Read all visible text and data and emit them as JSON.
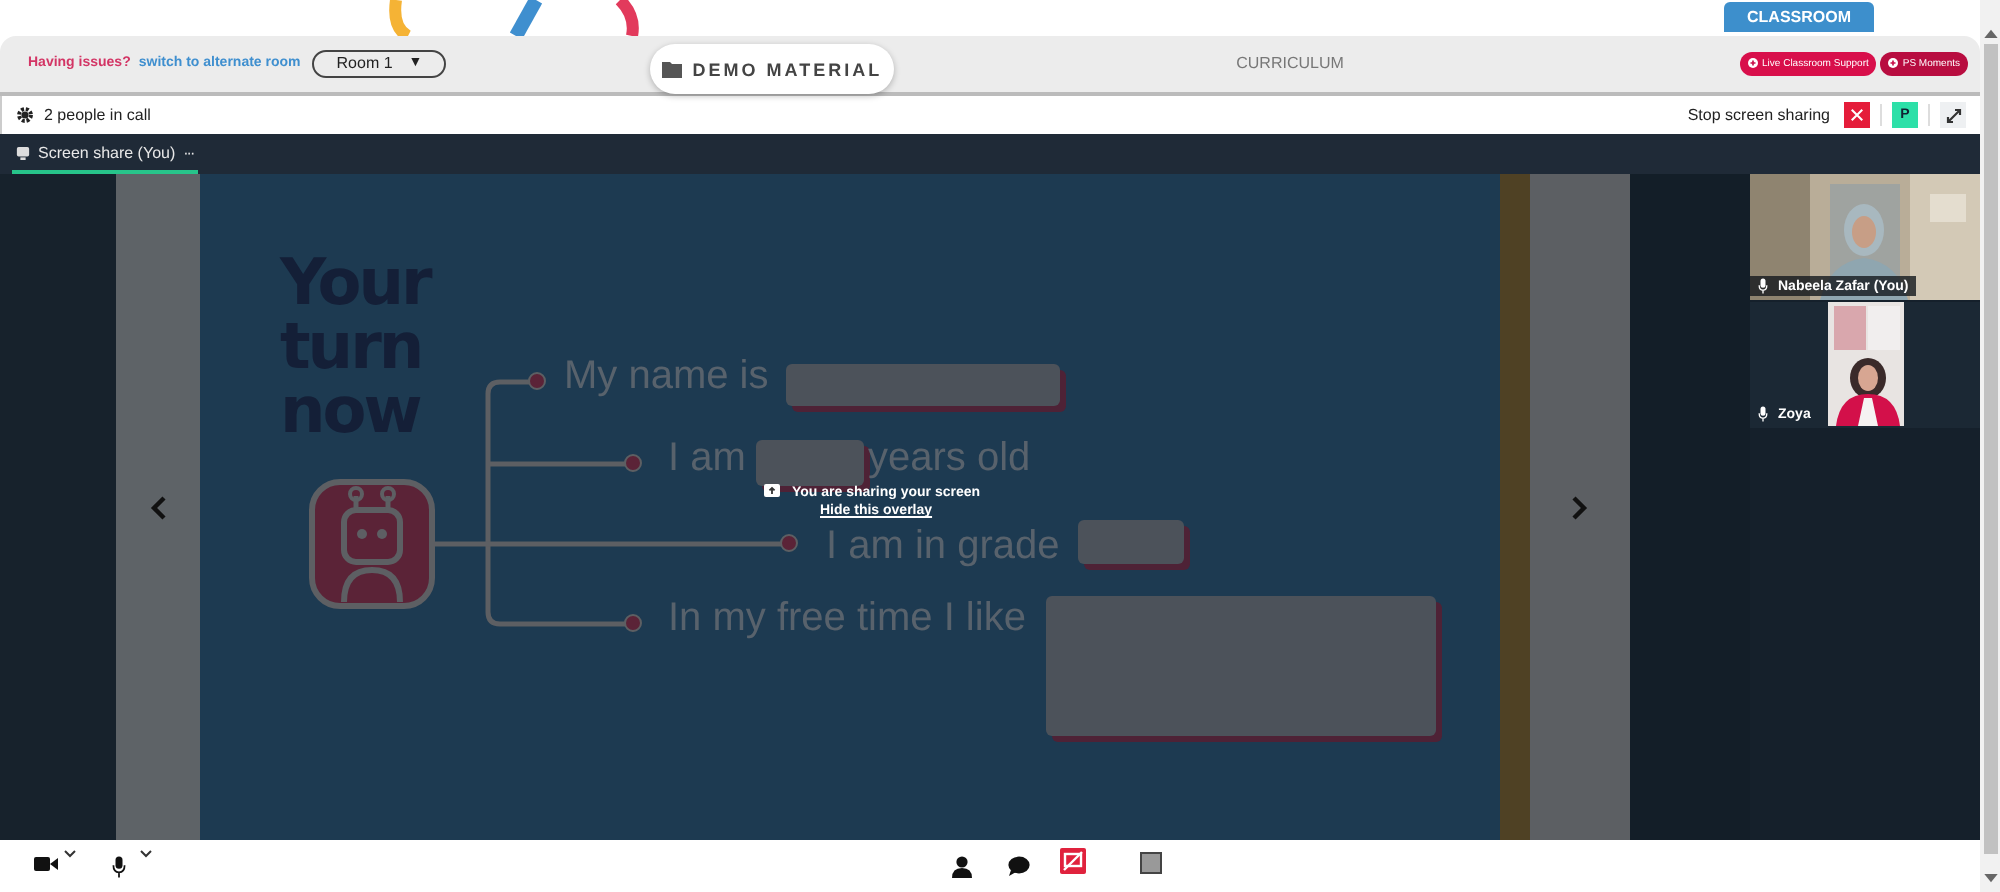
{
  "header": {
    "issue_text": "Having issues?",
    "switch_link": "switch to alternate room",
    "room_select": "Room 1",
    "room_caret": "▼",
    "demo_button": "DEMO MATERIAL",
    "curriculum_tab": "CURRICULUM",
    "classroom_tab": "CLASSROOM",
    "support_buttons": [
      "Live Classroom Support",
      "PS Moments"
    ]
  },
  "call": {
    "people_count": "2 people in call",
    "stop_label": "Stop screen sharing",
    "presenter_badge": "P",
    "tabs": [
      {
        "label": "Screen share (You)",
        "more": "···",
        "selected": true
      }
    ]
  },
  "slide": {
    "title_lines": [
      "Your",
      "turn",
      "now"
    ],
    "prompts": [
      {
        "before": "My name is"
      },
      {
        "before": "I am",
        "after": "years old"
      },
      {
        "before": "I am in grade"
      },
      {
        "before": "In my free time I like"
      }
    ],
    "overlay": {
      "message": "You are sharing your screen",
      "hide_link": "Hide this overlay"
    }
  },
  "participants": [
    {
      "name": "Nabeela Zafar (You)",
      "kind": "wide"
    },
    {
      "name": "Zoya",
      "kind": "narrow"
    }
  ]
}
